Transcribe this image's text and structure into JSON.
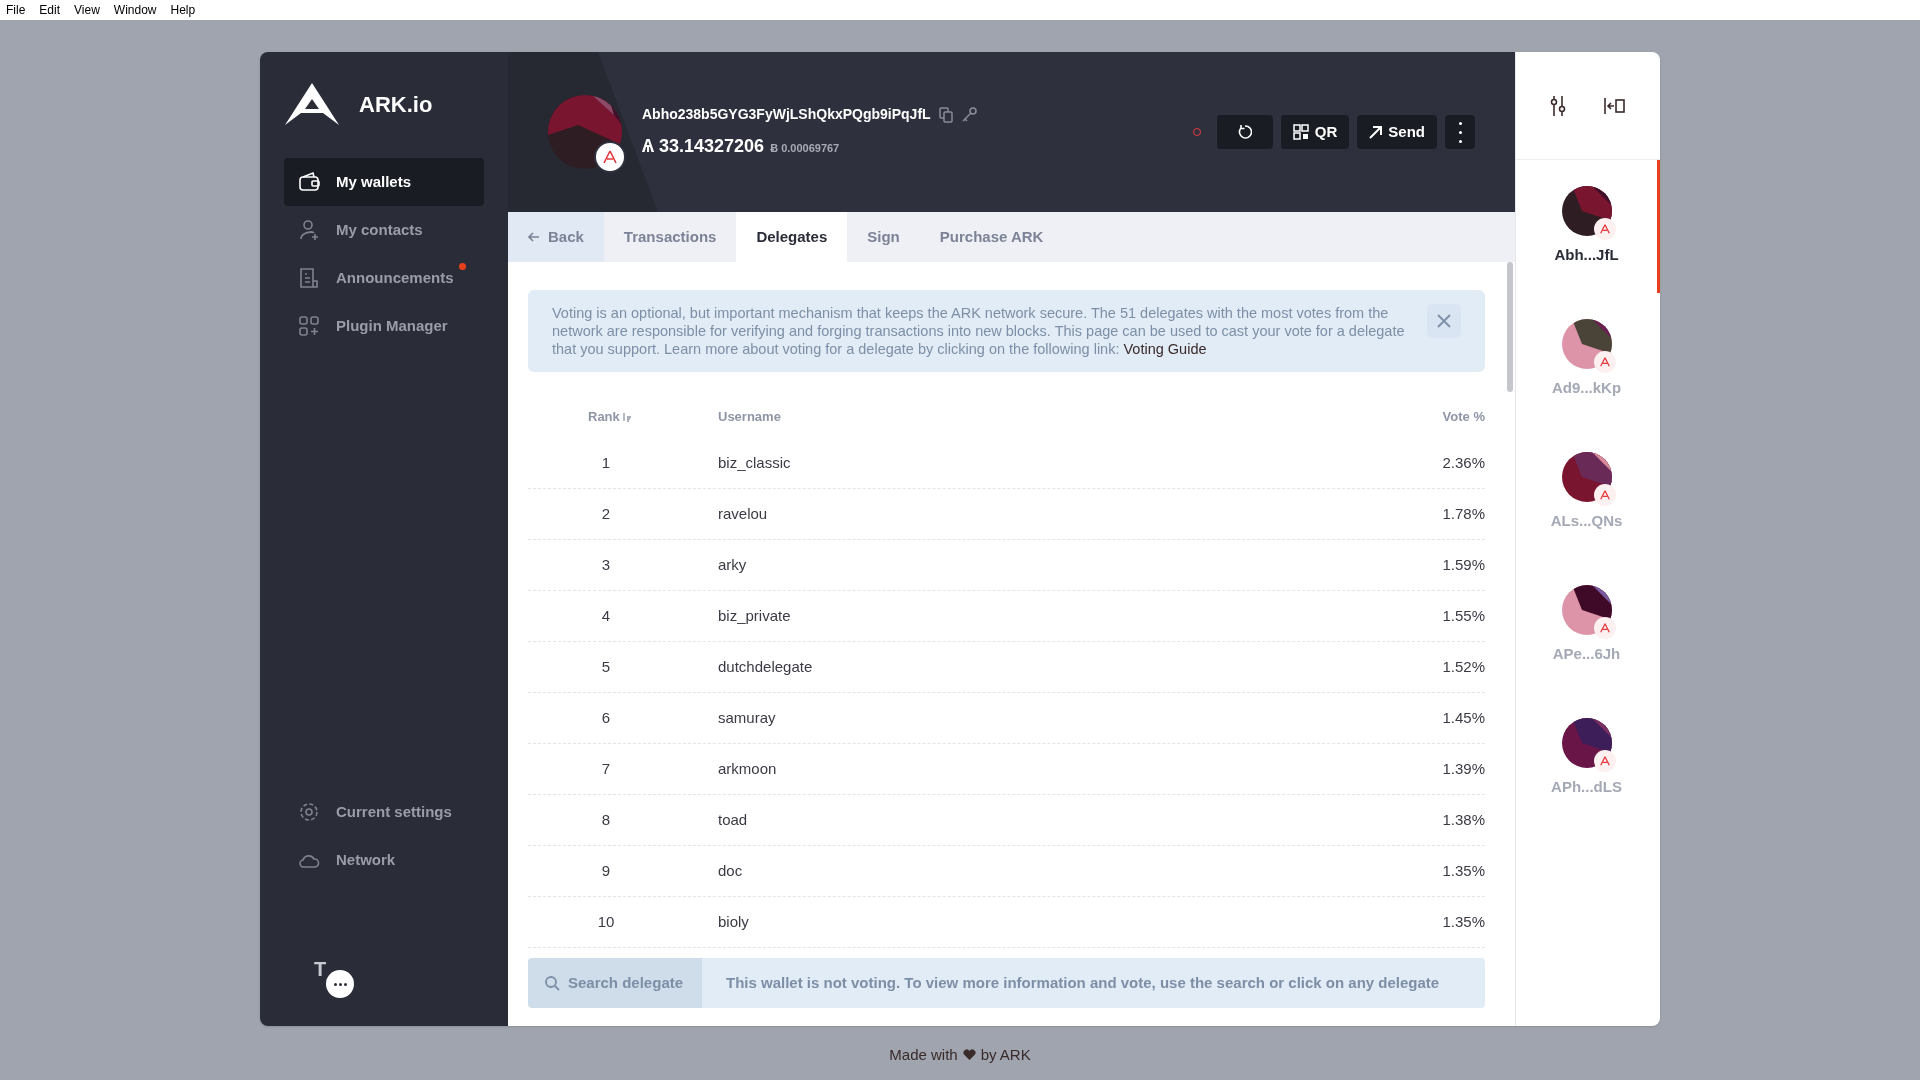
{
  "menu_bar": [
    "File",
    "Edit",
    "View",
    "Window",
    "Help"
  ],
  "sidebar": {
    "logo_text": "ARK.io",
    "items": [
      {
        "kind": "wallet",
        "label": "My wallets",
        "selected": true,
        "notification": false
      },
      {
        "kind": "contacts",
        "label": "My contacts",
        "selected": false,
        "notification": false
      },
      {
        "kind": "announcements",
        "label": "Announcements",
        "selected": false,
        "notification": true
      },
      {
        "kind": "plugins",
        "label": "Plugin Manager",
        "selected": false,
        "notification": false
      }
    ],
    "bottom_items": [
      {
        "kind": "settings",
        "label": "Current settings"
      },
      {
        "kind": "network",
        "label": "Network"
      }
    ],
    "profile_initial": "T"
  },
  "header": {
    "address": "Abho238b5GYG3FyWjLShQkxPQgb9iPqJfL",
    "currency_symbol": "Ѧ",
    "balance": "33.14327206",
    "fiat_symbol": "Ƀ",
    "fiat_balance": "0.00069767",
    "buttons": [
      {
        "kind": "refresh"
      },
      {
        "kind": "qr",
        "label": "QR"
      },
      {
        "kind": "send",
        "label": "Send"
      },
      {
        "kind": "more"
      }
    ]
  },
  "tabs": [
    {
      "kind": "back",
      "label": "Back",
      "selected": false
    },
    {
      "kind": "tab",
      "label": "Transactions",
      "selected": false
    },
    {
      "kind": "tab",
      "label": "Delegates",
      "selected": true
    },
    {
      "kind": "tab",
      "label": "Sign",
      "selected": false
    },
    {
      "kind": "tab",
      "label": "Purchase ARK",
      "selected": false
    }
  ],
  "notice": {
    "text": "Voting is an optional, but important mechanism that keeps the ARK network secure. The 51 delegates with the most votes from the network are responsible for verifying and forging transactions into new blocks. This page can be used to cast your vote for a delegate that you support. Learn more about voting for a delegate by clicking on the following link:",
    "link": "Voting Guide"
  },
  "table": {
    "columns": [
      "Rank",
      "Username",
      "Vote %"
    ],
    "rows": [
      [
        "1",
        "biz_classic",
        "2.36%"
      ],
      [
        "2",
        "ravelou",
        "1.78%"
      ],
      [
        "3",
        "arky",
        "1.59%"
      ],
      [
        "4",
        "biz_private",
        "1.55%"
      ],
      [
        "5",
        "dutchdelegate",
        "1.52%"
      ],
      [
        "6",
        "samuray",
        "1.45%"
      ],
      [
        "7",
        "arkmoon",
        "1.39%"
      ],
      [
        "8",
        "toad",
        "1.38%"
      ],
      [
        "9",
        "doc",
        "1.35%"
      ],
      [
        "10",
        "bioly",
        "1.35%"
      ]
    ]
  },
  "search": {
    "placeholder": "Search delegate"
  },
  "status_message": "This wallet is not voting. To view more information and vote, use the search or click on any delegate",
  "wallets": [
    {
      "label": "Abh...JfL",
      "selected": true
    },
    {
      "label": "Ad9...kKp",
      "selected": false
    },
    {
      "label": "ALs...QNs",
      "selected": false
    },
    {
      "label": "APe...6Jh",
      "selected": false
    },
    {
      "label": "APh...dLS",
      "selected": false
    }
  ],
  "footer": {
    "before": "Made with",
    "after": "by ARK"
  }
}
